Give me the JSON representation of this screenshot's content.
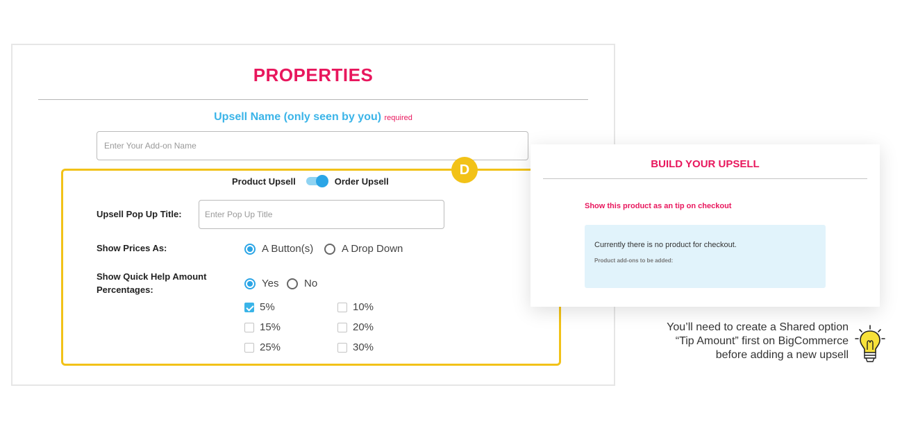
{
  "properties": {
    "title": "PROPERTIES",
    "upsell_name_label": "Upsell Name (only seen by you)",
    "required_label": "required",
    "upsell_name_placeholder": "Enter Your Add-on Name"
  },
  "badge": {
    "letter": "D"
  },
  "toggle": {
    "left_label": "Product Upsell",
    "right_label": "Order Upsell",
    "selected": "Order Upsell"
  },
  "popup_title": {
    "label": "Upsell Pop Up Title:",
    "placeholder": "Enter Pop Up Title"
  },
  "show_prices": {
    "label": "Show Prices As:",
    "options": [
      "A Button(s)",
      "A Drop Down"
    ],
    "selected": "A Button(s)"
  },
  "quick_help": {
    "label_line1": "Show Quick Help Amount",
    "label_line2": "Percentages:",
    "options": [
      "Yes",
      "No"
    ],
    "selected": "Yes",
    "percentages": [
      {
        "label": "5%",
        "checked": true
      },
      {
        "label": "10%",
        "checked": false
      },
      {
        "label": "15%",
        "checked": false
      },
      {
        "label": "20%",
        "checked": false
      },
      {
        "label": "25%",
        "checked": false
      },
      {
        "label": "30%",
        "checked": false
      }
    ]
  },
  "build_card": {
    "title": "BUILD YOUR UPSELL",
    "link": "Show this product as an tip on checkout",
    "box_main": "Currently there is no product for checkout.",
    "box_sub": "Product add-ons to be added:"
  },
  "tip": {
    "line1": "You’ll need to create a Shared option",
    "line2": "“Tip Amount” first on BigCommerce",
    "line3": "before adding a new upsell",
    "icon": "lightbulb-icon"
  },
  "colors": {
    "accent_pink": "#e8175d",
    "accent_blue": "#3ab4e8",
    "highlight_yellow": "#f2c218",
    "box_bg": "#e1f3fb"
  }
}
